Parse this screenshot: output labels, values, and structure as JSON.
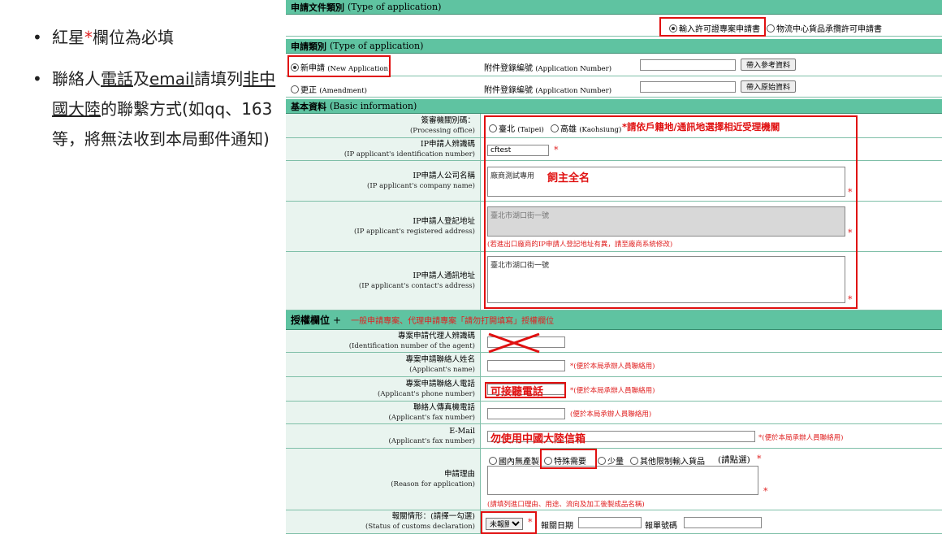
{
  "notes": {
    "n1_a": "紅星",
    "n1_star": "*",
    "n1_b": "欄位為必填",
    "n2_a": "聯絡人",
    "n2_phone": "電話",
    "n2_and": "及",
    "n2_email": "email",
    "n2_b": "請填列",
    "n2_nonchina": "非中國大陸",
    "n2_c": "的聯繫方式(如qq、163等，將無法收到本局郵件通知)"
  },
  "doc_type": {
    "title": "申請文件類別",
    "title_en": "(Type of application)",
    "opt1": "輸入許可證專案申請書",
    "opt2": "物流中心貨品承攬許可申請書"
  },
  "app_type": {
    "title": "申請類別",
    "title_en": "(Type of application)",
    "new_label": "新申請",
    "new_en": "(New Application)",
    "amend_label": "更正",
    "amend_en": "(Amendment)",
    "attach_label": "附件登錄編號",
    "attach_en": "(Application Number)",
    "btn_ref": "帶入參考資料",
    "btn_orig": "帶入原始資料"
  },
  "basic": {
    "title": "基本資料",
    "title_en": "(Basic information)",
    "office_label": "簽審機關別碼：",
    "office_en": "(Processing office)",
    "taipei": "臺北",
    "taipei_en": "(Taipei)",
    "kaohsiung": "高雄",
    "kaohsiung_en": "(Kaohsiung)",
    "office_note": "*請依戶籍地/通訊地選擇相近受理機關",
    "id_label": "IP申請人辨識碼",
    "id_en": "(IP applicant's identification number)",
    "id_value": "cftest",
    "company_label": "IP申請人公司名稱",
    "company_en": "(IP applicant's company name)",
    "company_value": "廠商測試專用",
    "company_ann": "飼主全名",
    "reg_label": "IP申請人登記地址",
    "reg_en": "(IP applicant's registered address)",
    "reg_value": "臺北市湖口街一號",
    "reg_hint": "(若進出口廠商的IP申請人登記地址有異，請至廠商系統修改)",
    "contact_label": "IP申請人通訊地址",
    "contact_en": "(IP applicant's contact's address)",
    "contact_value": "臺北市湖口街一號"
  },
  "auth": {
    "title": "授權欄位",
    "plus": "+",
    "note": "一般申請專案、代理申請專案「請勿打開填寫」授權欄位",
    "agent_label": "專案申請代理人辨識碼",
    "agent_en": "(Identification number of the agent)",
    "name_label": "專案申請聯絡人姓名",
    "name_en": "(Applicant's name)",
    "name_hint": "*(便於本局承辦人員聯絡用)",
    "phone_label": "專案申請聯絡人電話",
    "phone_en": "(Applicant's phone number)",
    "phone_ann": "可接聽電話",
    "phone_hint": "*(便於本局承辦人員聯絡用)",
    "fax_label": "聯絡人傳真機電話",
    "fax_en": "(Applicant's fax number)",
    "fax_hint": "(便於本局承辦人員聯絡用)",
    "email_label": "E-Mail",
    "email_en": "(Applicant's fax number)",
    "email_ann": "勿使用中國大陸信箱",
    "email_hint": "*(便於本局承辦人員聯絡用)",
    "reason_label": "申請理由",
    "reason_en": "(Reason for application)",
    "r1": "國內無產製",
    "r2": "特殊需要",
    "r3": "少量",
    "r4": "其他限制輸入貨品",
    "r_select": "(請點選)",
    "r_star": "*",
    "reason_hint": "(請填列進口理由、用途、流向及加工後製成品名稱)",
    "customs_label": "報關情形：(請擇一勾選)",
    "customs_en": "(Status of customs declaration)",
    "customs_option": "未報關",
    "customs_date": "報關日期",
    "customs_no": "報單號碼"
  },
  "star": "*"
}
